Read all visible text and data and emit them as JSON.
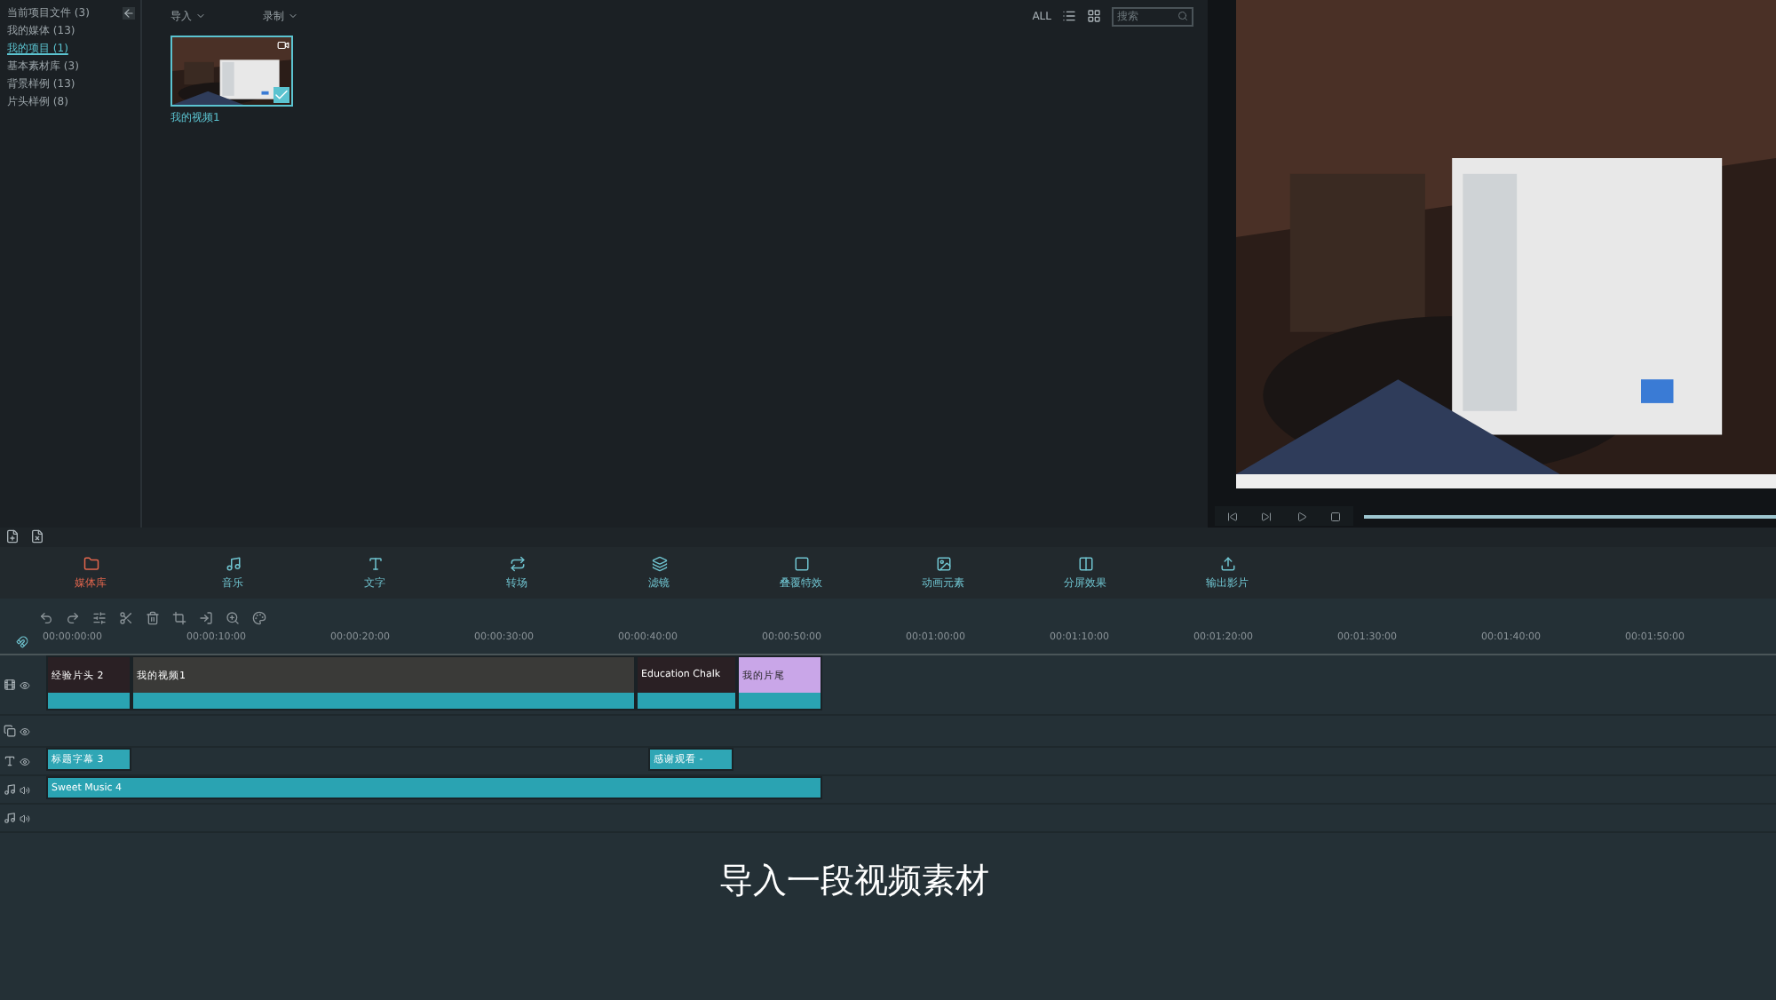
{
  "library": {
    "items": [
      {
        "label": "当前项目文件 (3)",
        "selected": false
      },
      {
        "label": "我的媒体 (13)",
        "selected": false
      },
      {
        "label": "我的项目 (1)",
        "selected": true
      },
      {
        "label": "基本素材库 (3)",
        "selected": false
      },
      {
        "label": "背景样例 (13)",
        "selected": false
      },
      {
        "label": "片头样例 (8)",
        "selected": false
      }
    ]
  },
  "media_toolbar": {
    "menus": [
      "导入",
      "录制"
    ],
    "filter": "ALL",
    "search": {
      "placeholder": "搜索"
    }
  },
  "media_items": [
    {
      "label": "我的视频1",
      "checked": true
    }
  ],
  "tabs": [
    {
      "label": "媒体库",
      "selected": true
    },
    {
      "label": "音乐",
      "selected": false
    },
    {
      "label": "文字",
      "selected": false
    },
    {
      "label": "转场",
      "selected": false
    },
    {
      "label": "滤镜",
      "selected": false
    },
    {
      "label": "叠覆特效",
      "selected": false
    },
    {
      "label": "动画元素",
      "selected": false
    },
    {
      "label": "分屏效果",
      "selected": false
    },
    {
      "label": "输出影片",
      "selected": false
    }
  ],
  "ruler": [
    "00:00:00:00",
    "00:00:10:00",
    "00:00:20:00",
    "00:00:30:00",
    "00:00:40:00",
    "00:00:50:00",
    "00:01:00:00",
    "00:01:10:00",
    "00:01:20:00",
    "00:01:30:00",
    "00:01:40:00",
    "00:01:50:00"
  ],
  "tracks": [
    {
      "kind": "video",
      "clips": [
        {
          "label": "经验片头 2",
          "kind": "title"
        },
        {
          "label": "我的视频1",
          "kind": "video"
        },
        {
          "label": "Education Chalk",
          "kind": "title"
        },
        {
          "label": "我的片尾",
          "kind": "ending"
        }
      ]
    },
    {
      "kind": "overlay"
    },
    {
      "kind": "text",
      "clips": [
        {
          "label": "标题字幕 3"
        },
        {
          "label": "感谢观看 -"
        }
      ]
    },
    {
      "kind": "audio",
      "clips": [
        {
          "label": "Sweet Music 4"
        }
      ]
    },
    {
      "kind": "audio"
    }
  ],
  "subtitle": "导入一段视频素材"
}
